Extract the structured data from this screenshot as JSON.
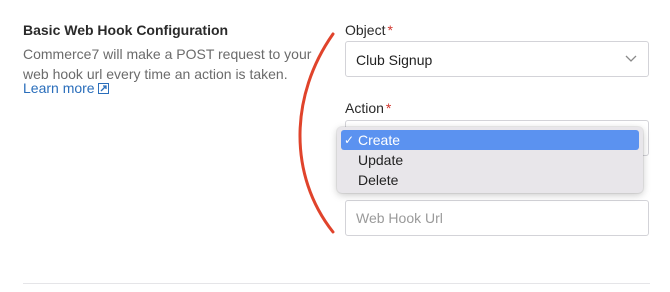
{
  "section": {
    "title": "Basic Web Hook Configuration",
    "description": "Commerce7 will make a POST request to your web hook url every time an action is taken.",
    "learn_more": "Learn more"
  },
  "object_field": {
    "label": "Object",
    "required_mark": "*",
    "value": "Club Signup"
  },
  "action_field": {
    "label": "Action",
    "required_mark": "*",
    "options": [
      {
        "label": "Create",
        "selected": true,
        "check": "✓"
      },
      {
        "label": "Update",
        "selected": false
      },
      {
        "label": "Delete",
        "selected": false
      }
    ]
  },
  "url_field": {
    "placeholder": "Web Hook Url"
  },
  "colors": {
    "link": "#2a6ebb",
    "required": "#d0342c",
    "selected_option": "#5b92f0",
    "annotation": "#e0432b"
  },
  "icons": {
    "learn_more": "external-link-icon",
    "select": "chevron-down-icon",
    "selected_option": "check-icon"
  }
}
